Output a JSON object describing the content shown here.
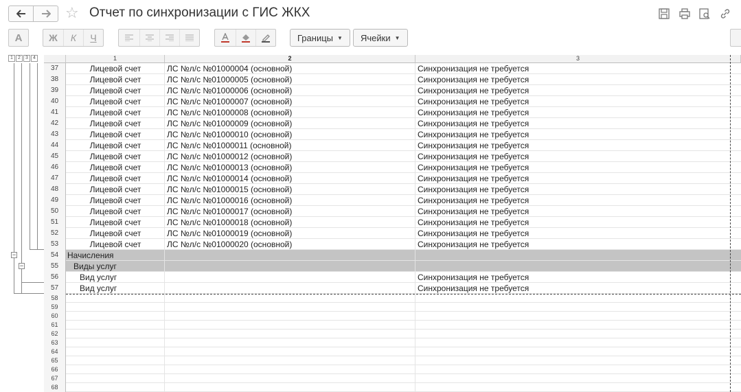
{
  "window": {
    "title": "Отчет по синхронизации с ГИС ЖКХ",
    "back_icon": "arrow-left-icon",
    "forward_icon": "arrow-right-icon",
    "favorite_icon": "star-icon",
    "tools": [
      "save-icon",
      "print-icon",
      "preview-icon",
      "link-icon"
    ]
  },
  "toolbar": {
    "font_label": "A",
    "bold_label": "Ж",
    "italic_label": "К",
    "underline_label": "Ч",
    "borders_label": "Границы",
    "cells_label": "Ячейки"
  },
  "outline_levels": [
    "1",
    "2",
    "3",
    "4"
  ],
  "columns": [
    "1",
    "2",
    "3"
  ],
  "rows": [
    {
      "n": "37",
      "c1": "Лицевой счет",
      "c2": "ЛС №л/с №01000004 (основной)",
      "c3": "Синхронизация не требуется"
    },
    {
      "n": "38",
      "c1": "Лицевой счет",
      "c2": "ЛС №л/с №01000005 (основной)",
      "c3": "Синхронизация не требуется"
    },
    {
      "n": "39",
      "c1": "Лицевой счет",
      "c2": "ЛС №л/с №01000006 (основной)",
      "c3": "Синхронизация не требуется"
    },
    {
      "n": "40",
      "c1": "Лицевой счет",
      "c2": "ЛС №л/с №01000007 (основной)",
      "c3": "Синхронизация не требуется"
    },
    {
      "n": "41",
      "c1": "Лицевой счет",
      "c2": "ЛС №л/с №01000008 (основной)",
      "c3": "Синхронизация не требуется"
    },
    {
      "n": "42",
      "c1": "Лицевой счет",
      "c2": "ЛС №л/с №01000009 (основной)",
      "c3": "Синхронизация не требуется"
    },
    {
      "n": "43",
      "c1": "Лицевой счет",
      "c2": "ЛС №л/с №01000010 (основной)",
      "c3": "Синхронизация не требуется"
    },
    {
      "n": "44",
      "c1": "Лицевой счет",
      "c2": "ЛС №л/с №01000011 (основной)",
      "c3": "Синхронизация не требуется"
    },
    {
      "n": "45",
      "c1": "Лицевой счет",
      "c2": "ЛС №л/с №01000012 (основной)",
      "c3": "Синхронизация не требуется"
    },
    {
      "n": "46",
      "c1": "Лицевой счет",
      "c2": "ЛС №л/с №01000013 (основной)",
      "c3": "Синхронизация не требуется"
    },
    {
      "n": "47",
      "c1": "Лицевой счет",
      "c2": "ЛС №л/с №01000014 (основной)",
      "c3": "Синхронизация не требуется"
    },
    {
      "n": "48",
      "c1": "Лицевой счет",
      "c2": "ЛС №л/с №01000015 (основной)",
      "c3": "Синхронизация не требуется"
    },
    {
      "n": "49",
      "c1": "Лицевой счет",
      "c2": "ЛС №л/с №01000016 (основной)",
      "c3": "Синхронизация не требуется"
    },
    {
      "n": "50",
      "c1": "Лицевой счет",
      "c2": "ЛС №л/с №01000017 (основной)",
      "c3": "Синхронизация не требуется"
    },
    {
      "n": "51",
      "c1": "Лицевой счет",
      "c2": "ЛС №л/с №01000018 (основной)",
      "c3": "Синхронизация не требуется"
    },
    {
      "n": "52",
      "c1": "Лицевой счет",
      "c2": "ЛС №л/с №01000019 (основной)",
      "c3": "Синхронизация не требуется"
    },
    {
      "n": "53",
      "c1": "Лицевой счет",
      "c2": "ЛС №л/с №01000020 (основной)",
      "c3": "Синхронизация не требуется"
    },
    {
      "n": "54",
      "group": "Начисления"
    },
    {
      "n": "55",
      "group": "Виды услуг"
    },
    {
      "n": "56",
      "c1": "Вид услуг",
      "c2": "",
      "c3": "Синхронизация не требуется"
    },
    {
      "n": "57",
      "c1": "Вид услуг",
      "c2": "",
      "c3": "Синхронизация не требуется"
    }
  ],
  "empty_rows": [
    "58",
    "59",
    "60",
    "61",
    "62",
    "63",
    "64",
    "65",
    "66",
    "67",
    "68"
  ]
}
